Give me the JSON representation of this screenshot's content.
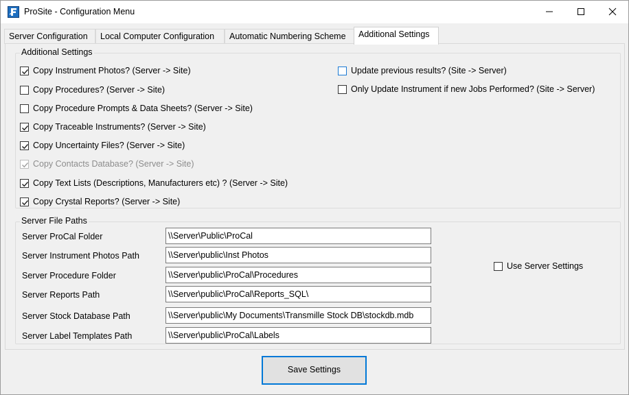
{
  "window": {
    "title": "ProSite - Configuration Menu"
  },
  "tabs": [
    {
      "label": "Server Configuration"
    },
    {
      "label": "Local Computer Configuration"
    },
    {
      "label": "Automatic Numbering Scheme"
    },
    {
      "label": "Additional Settings"
    }
  ],
  "additional_settings": {
    "group_title": "Additional Settings",
    "items": [
      {
        "label": "Copy Instrument Photos? (Server -> Site)",
        "checked": true
      },
      {
        "label": "Copy Procedures? (Server -> Site)",
        "checked": false
      },
      {
        "label": "Copy Procedure Prompts & Data Sheets? (Server -> Site)",
        "checked": false
      },
      {
        "label": "Copy Traceable Instruments? (Server -> Site)",
        "checked": true
      },
      {
        "label": "Copy Uncertainty Files? (Server -> Site)",
        "checked": true
      },
      {
        "label": "Copy Contacts Database? (Server -> Site)",
        "checked": true,
        "disabled": true
      },
      {
        "label": "Copy Text Lists (Descriptions, Manufacturers etc) ? (Server -> Site)",
        "checked": true
      },
      {
        "label": "Copy Crystal Reports? (Server -> Site)",
        "checked": true
      }
    ],
    "right_items": [
      {
        "label": "Update previous results? (Site -> Server)",
        "checked": false
      },
      {
        "label": "Only Update Instrument if new Jobs Performed? (Site -> Server)",
        "checked": false
      }
    ]
  },
  "server_file_paths": {
    "group_title": "Server File Paths",
    "rows": [
      {
        "label": "Server ProCal Folder",
        "value": "\\\\Server\\Public\\ProCal"
      },
      {
        "label": "Server Instrument Photos Path",
        "value": "\\\\Server\\public\\Inst Photos"
      },
      {
        "label": "Server Procedure Folder",
        "value": "\\\\Server\\public\\ProCal\\Procedures"
      },
      {
        "label": "Server Reports Path",
        "value": "\\\\Server\\public\\ProCal\\Reports_SQL\\"
      },
      {
        "label": "Server Stock Database Path",
        "value": "\\\\Server\\public\\My Documents\\Transmille Stock DB\\stockdb.mdb"
      },
      {
        "label": "Server Label Templates Path",
        "value": "\\\\Server\\public\\ProCal\\Labels"
      }
    ],
    "use_server_settings": {
      "label": "Use Server Settings",
      "checked": false
    }
  },
  "footer": {
    "save_label": "Save Settings"
  },
  "icons": {
    "app": "prosite-app-icon",
    "minimize": "minimize-icon",
    "maximize": "maximize-icon",
    "close": "close-icon",
    "check": "checkmark-icon"
  },
  "colors": {
    "accent": "#0078d7",
    "check_blue_border": "#1979d3"
  }
}
